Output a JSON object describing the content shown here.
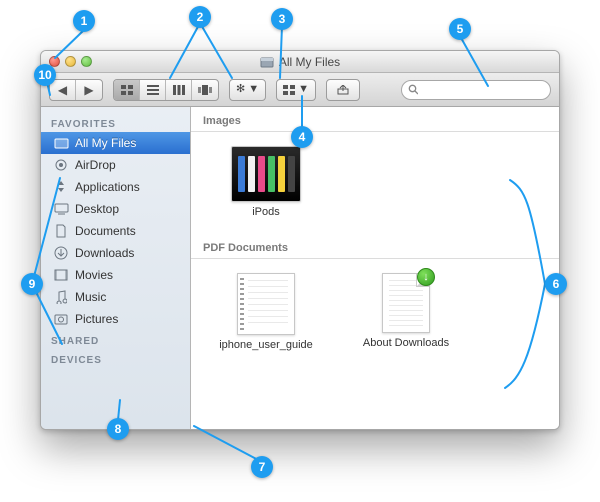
{
  "window": {
    "title": "All My Files"
  },
  "toolbar": {
    "search_placeholder": ""
  },
  "sidebar": {
    "sections": [
      {
        "header": "FAVORITES",
        "items": [
          {
            "label": "All My Files",
            "icon": "all-my-files",
            "selected": true
          },
          {
            "label": "AirDrop",
            "icon": "airdrop"
          },
          {
            "label": "Applications",
            "icon": "applications"
          },
          {
            "label": "Desktop",
            "icon": "desktop"
          },
          {
            "label": "Documents",
            "icon": "documents"
          },
          {
            "label": "Downloads",
            "icon": "downloads"
          },
          {
            "label": "Movies",
            "icon": "movies"
          },
          {
            "label": "Music",
            "icon": "music"
          },
          {
            "label": "Pictures",
            "icon": "pictures"
          }
        ]
      },
      {
        "header": "SHARED",
        "items": []
      },
      {
        "header": "DEVICES",
        "items": []
      }
    ]
  },
  "content": {
    "groups": [
      {
        "header": "Images",
        "items": [
          {
            "label": "iPods",
            "kind": "image-ipods"
          }
        ]
      },
      {
        "header": "PDF Documents",
        "items": [
          {
            "label": "iphone_user_guide",
            "kind": "pdf-spiral"
          },
          {
            "label": "About Downloads",
            "kind": "pdf-download"
          }
        ]
      }
    ]
  },
  "callouts": {
    "c1": "1",
    "c2": "2",
    "c3": "3",
    "c4": "4",
    "c5": "5",
    "c6": "6",
    "c7": "7",
    "c8": "8",
    "c9": "9",
    "c10": "10"
  },
  "colors": {
    "accent": "#1e9df0",
    "selection": "#3a7fd9"
  }
}
